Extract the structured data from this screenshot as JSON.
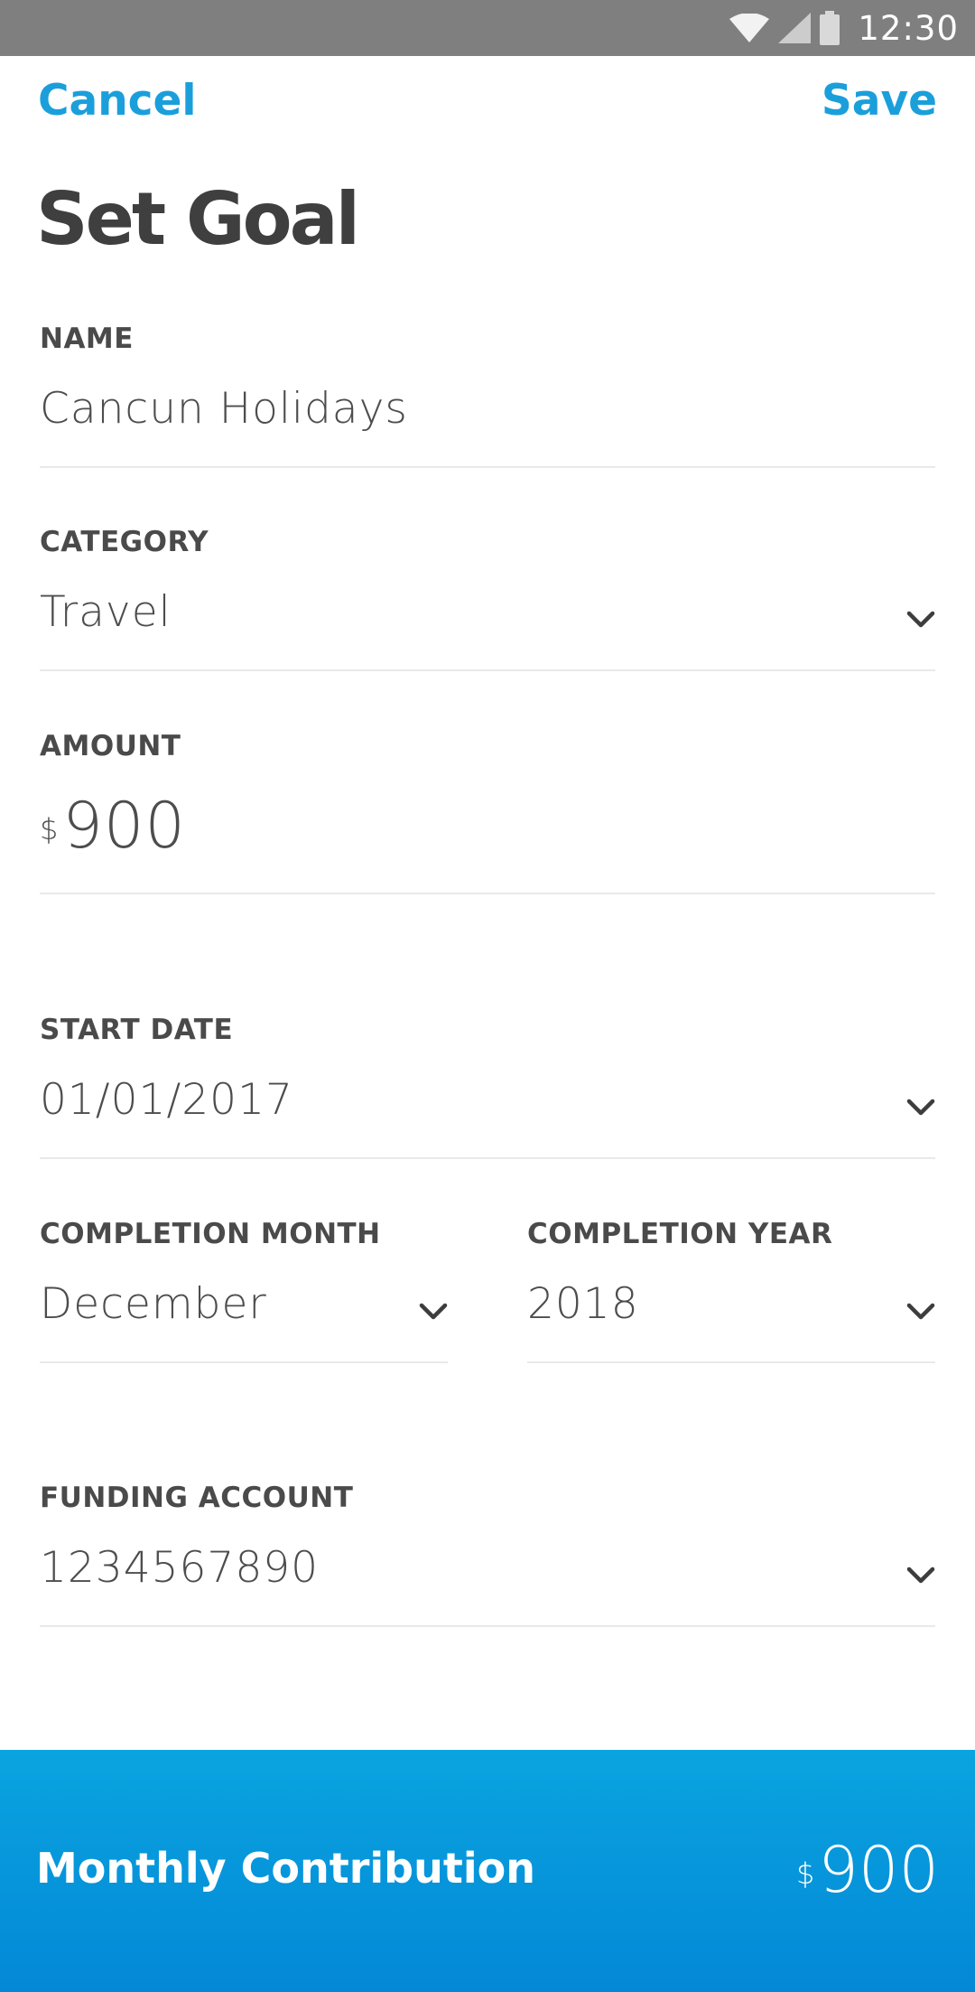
{
  "status_bar": {
    "time": "12:30",
    "icons": [
      "wifi-icon",
      "cell-signal-icon",
      "battery-icon"
    ]
  },
  "header": {
    "cancel_label": "Cancel",
    "save_label": "Save",
    "title": "Set Goal"
  },
  "form": {
    "name": {
      "label": "NAME",
      "value": "Cancun Holidays"
    },
    "category": {
      "label": "CATEGORY",
      "value": "Travel"
    },
    "amount": {
      "label": "AMOUNT",
      "currency": "$",
      "value": "900"
    },
    "start_date": {
      "label": "START DATE",
      "value": "01/01/2017"
    },
    "completion_month": {
      "label": "COMPLETION MONTH",
      "value": "December"
    },
    "completion_year": {
      "label": "COMPLETION YEAR",
      "value": "2018"
    },
    "funding_account": {
      "label": "FUNDING ACCOUNT",
      "value": "1234567890"
    }
  },
  "footer": {
    "label": "Monthly Contribution",
    "currency": "$",
    "amount": "900"
  },
  "colors": {
    "accent": "#1a9fdb",
    "footer_gradient_top": "#0aa4e0",
    "footer_gradient_bottom": "#0388d6",
    "status_bar": "#7f7f7f"
  }
}
